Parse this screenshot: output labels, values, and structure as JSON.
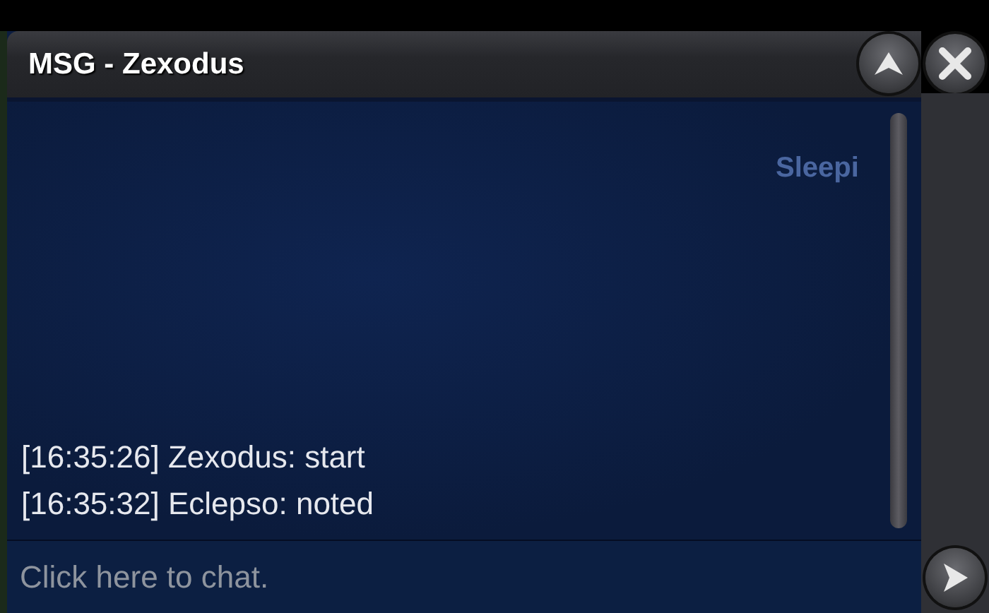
{
  "window": {
    "title": "MSG - Zexodus"
  },
  "background_label": "Sleepi",
  "messages": [
    {
      "text": "[16:35:26] Zexodus: start"
    },
    {
      "text": "[16:35:32] Eclepso: noted"
    }
  ],
  "chat_input": {
    "placeholder": "Click here to chat."
  }
}
